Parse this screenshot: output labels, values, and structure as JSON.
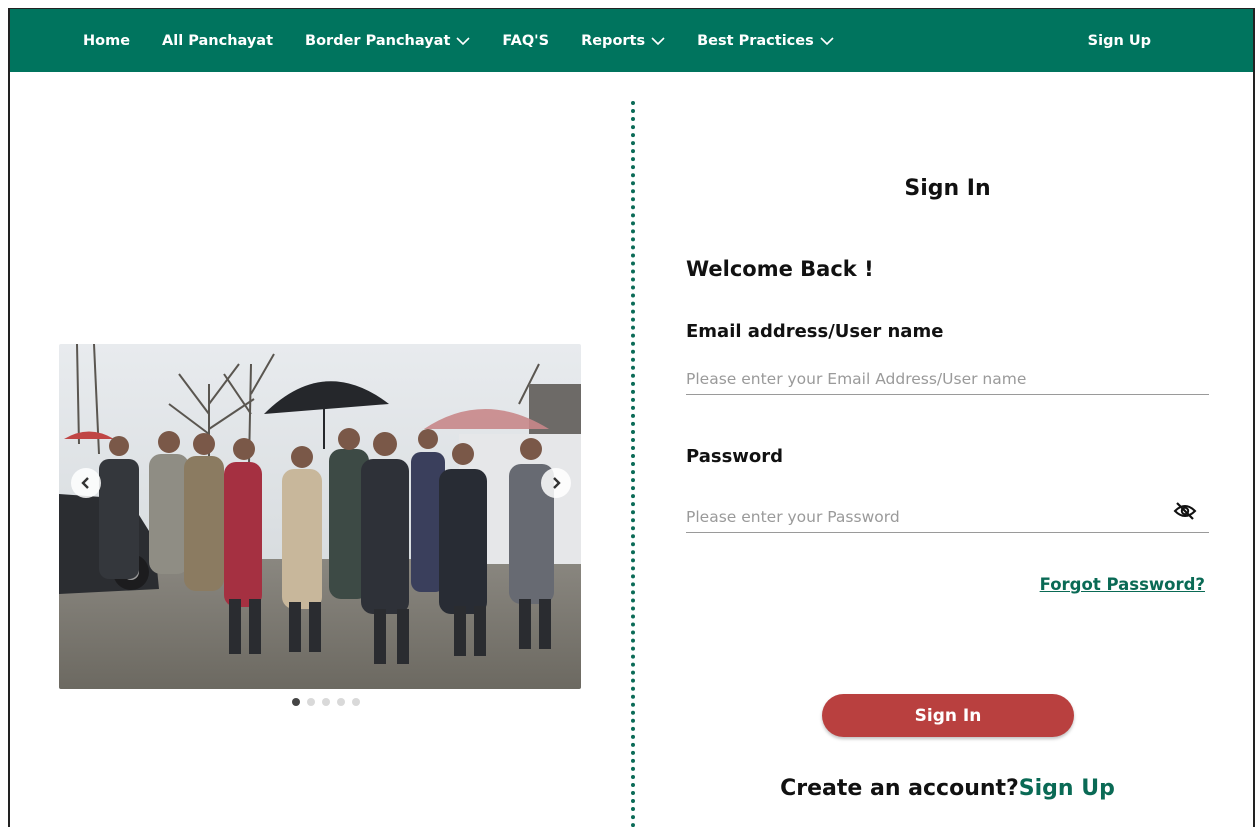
{
  "nav": {
    "items": [
      {
        "label": "Home",
        "has_dropdown": false
      },
      {
        "label": "All Panchayat",
        "has_dropdown": false
      },
      {
        "label": "Border Panchayat",
        "has_dropdown": true
      },
      {
        "label": "FAQ'S",
        "has_dropdown": false
      },
      {
        "label": "Reports",
        "has_dropdown": true
      },
      {
        "label": "Best Practices",
        "has_dropdown": true
      }
    ],
    "signup_label": "Sign Up",
    "background": "#00745e"
  },
  "carousel": {
    "slide_count": 5,
    "active_index": 0,
    "prev_icon": "chevron-left-icon",
    "next_icon": "chevron-right-icon"
  },
  "form": {
    "title": "Sign In",
    "welcome": "Welcome Back !",
    "email": {
      "label": "Email address/User name",
      "placeholder": "Please enter your Email Address/User name",
      "value": ""
    },
    "password": {
      "label": "Password",
      "placeholder": "Please enter your Password",
      "value": "",
      "toggle_icon": "eye-off-icon"
    },
    "forgot_label": "Forgot Password?",
    "submit_label": "Sign In",
    "create_prefix": "Create an account?",
    "create_link": "Sign Up"
  },
  "colors": {
    "primary": "#00745e",
    "button": "#b9403f",
    "link": "#0a6a55"
  }
}
